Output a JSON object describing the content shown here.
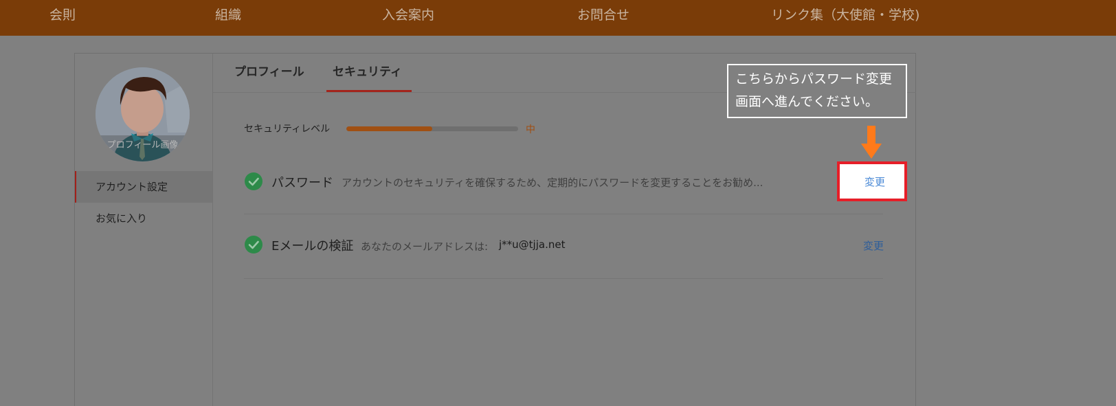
{
  "topnav": {
    "items": [
      "会則",
      "組織",
      "入会案内",
      "お問合せ",
      "リンク集（大使館・学校)"
    ]
  },
  "sidebar": {
    "avatar_label": "プロフィール画像",
    "items": [
      {
        "label": "アカウント設定",
        "active": true
      },
      {
        "label": "お気に入り",
        "active": false
      }
    ]
  },
  "tabs": [
    {
      "label": "プロフィール",
      "active": false
    },
    {
      "label": "セキュリティ",
      "active": true
    }
  ],
  "security_level": {
    "label": "セキュリティレベル",
    "value": "中",
    "progress": 0.5
  },
  "rows": [
    {
      "title": "パスワード",
      "description": "アカウントのセキュリティを確保するため、定期的にパスワードを変更することをお勧め...",
      "action": "変更"
    },
    {
      "title": "Eメールの検証",
      "description": "あなたのメールアドレスは:",
      "value": "j**u@tjja.net",
      "action": "変更"
    }
  ],
  "callout": {
    "line1": "こちらからパスワード変更",
    "line2": "画面へ進んでください。"
  },
  "colors": {
    "topnav_bg": "#7a3c08",
    "accent_red": "#e61e28",
    "arrow_orange": "#ff7a1a",
    "check_green": "#2d8a49",
    "link_blue": "#4b8ad6"
  }
}
